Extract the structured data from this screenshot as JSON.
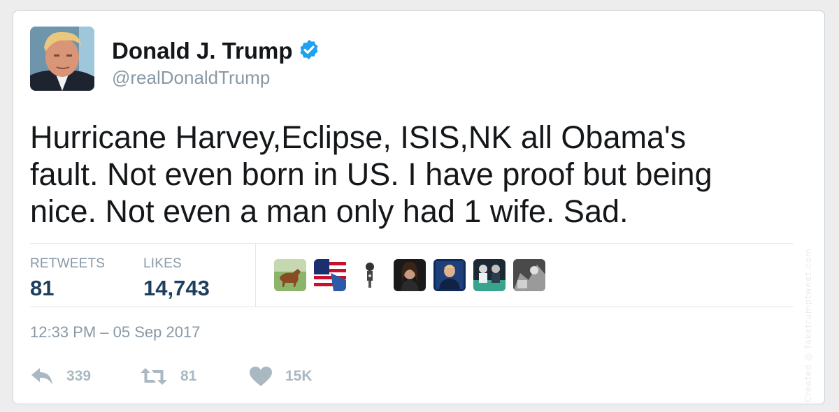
{
  "author": {
    "display_name": "Donald J. Trump",
    "handle": "@realDonaldTrump",
    "verified": true,
    "avatar_icon": "profile-photo"
  },
  "tweet": {
    "lines": [
      "Hurricane Harvey,Eclipse, ISIS,NK all Obama's",
      "fault. Not even born in US. I have proof but being",
      "nice. Not even a man only had 1 wife. Sad."
    ]
  },
  "stats": {
    "retweets_label": "RETWEETS",
    "retweets_value": "81",
    "likes_label": "LIKES",
    "likes_value": "14,743"
  },
  "likers": [
    {
      "name": "horse-avatar"
    },
    {
      "name": "flag-avatar"
    },
    {
      "name": "statue-avatar"
    },
    {
      "name": "woman-avatar"
    },
    {
      "name": "man-avatar"
    },
    {
      "name": "group-avatar"
    },
    {
      "name": "bw-photo-avatar"
    }
  ],
  "timestamp": "12:33 PM – 05 Sep 2017",
  "actions": {
    "reply_count": "339",
    "retweet_count": "81",
    "like_count": "15K"
  },
  "watermark": "Created @ faketrumptweet.com",
  "colors": {
    "verified": "#1da1f2",
    "text": "#14171a",
    "muted": "#8899a6",
    "stat_value": "#1d3f5e",
    "action_icon": "#aab8c2"
  }
}
